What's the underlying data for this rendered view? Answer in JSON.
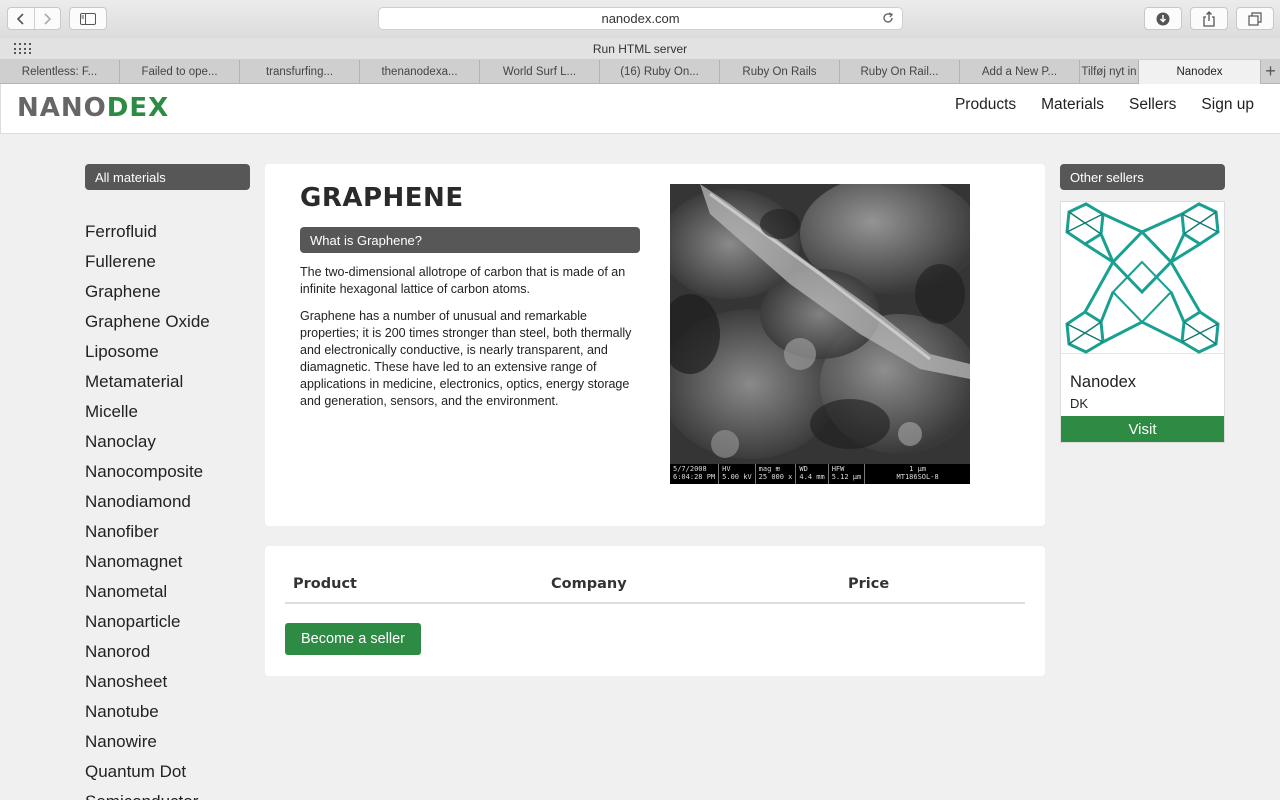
{
  "browser": {
    "url": "nanodex.com",
    "favorites_title": "Run HTML server",
    "tabs": [
      "Relentless: F...",
      "Failed to ope...",
      "transfurfing...",
      "thenanodexa...",
      "World Surf L...",
      "(16) Ruby On...",
      "Ruby On Rails",
      "Ruby On Rail...",
      "Add a New P...",
      "Tilføj nyt in",
      "Nanodex"
    ],
    "new_tab_label": "+"
  },
  "site": {
    "logo_part1": "NANO",
    "logo_part2": "DEX",
    "nav": [
      "Products",
      "Materials",
      "Sellers",
      "Sign up"
    ],
    "colors": {
      "brand_green": "#2e8b43",
      "pill_gray": "#575757"
    }
  },
  "sidebar": {
    "heading": "All materials",
    "materials": [
      "Ferrofluid",
      "Fullerene",
      "Graphene",
      "Graphene Oxide",
      "Liposome",
      "Metamaterial",
      "Micelle",
      "Nanoclay",
      "Nanocomposite",
      "Nanodiamond",
      "Nanofiber",
      "Nanomagnet",
      "Nanometal",
      "Nanoparticle",
      "Nanorod",
      "Nanosheet",
      "Nanotube",
      "Nanowire",
      "Quantum Dot",
      "Semiconductor"
    ]
  },
  "material": {
    "title": "GRAPHENE",
    "subheading": "What is Graphene?",
    "paragraph1": "The two-dimensional allotrope of carbon that is made of an infinite hexagonal lattice of carbon atoms.",
    "paragraph2": "Graphene has a number of unusual and remarkable properties; it is 200 times stronger than steel, both thermally and electronically conductive, is nearly transparent, and diamagnetic. These have led to an extensive range of applications in medicine, electronics, optics, energy storage and generation, sensors, and the environment.",
    "image_meta": {
      "date": "5/7/2008",
      "time": "6:04:28 PM",
      "hv_label": "HV",
      "hv": "5.00 kV",
      "mag_label": "mag ⊞",
      "mag": "25 000 x",
      "wd_label": "WD",
      "wd": "4.4 mm",
      "hfw_label": "HFW",
      "hfw": "5.12 µm",
      "scale": "1 µm",
      "sample": "MT186SOL-8"
    }
  },
  "products_table": {
    "columns": [
      "Product",
      "Company",
      "Price"
    ],
    "become_seller": "Become a seller"
  },
  "other_sellers": {
    "heading": "Other sellers",
    "seller": {
      "name": "Nanodex",
      "country": "DK",
      "visit_label": "Visit"
    }
  }
}
